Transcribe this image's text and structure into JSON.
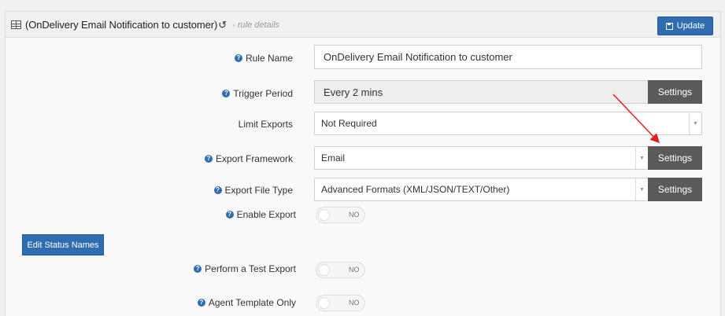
{
  "header": {
    "title": "(OnDelivery Email Notification to customer)",
    "subtitle": "- rule details",
    "update_label": "Update"
  },
  "fields": {
    "rule_name": {
      "label": "Rule Name",
      "value": "OnDelivery Email Notification to customer"
    },
    "trigger_period": {
      "label": "Trigger Period",
      "value": "Every 2 mins",
      "settings_label": "Settings"
    },
    "limit_exports": {
      "label": "Limit Exports",
      "value": "Not Required"
    },
    "export_framework": {
      "label": "Export Framework",
      "value": "Email",
      "settings_label": "Settings"
    },
    "export_file_type": {
      "label": "Export File Type",
      "value": "Advanced Formats (XML/JSON/TEXT/Other)",
      "settings_label": "Settings"
    },
    "enable_export": {
      "label": "Enable Export",
      "state": "NO"
    },
    "perform_test_export": {
      "label": "Perform a Test Export",
      "state": "NO"
    },
    "agent_template_only": {
      "label": "Agent Template Only",
      "state": "NO"
    }
  },
  "buttons": {
    "edit_status_names": "Edit Status Names"
  },
  "icons": {
    "help": "?",
    "history": "↺"
  },
  "colors": {
    "primary": "#2f6db0",
    "settings": "#5a5a5a",
    "annotation_arrow": "#e02020"
  }
}
